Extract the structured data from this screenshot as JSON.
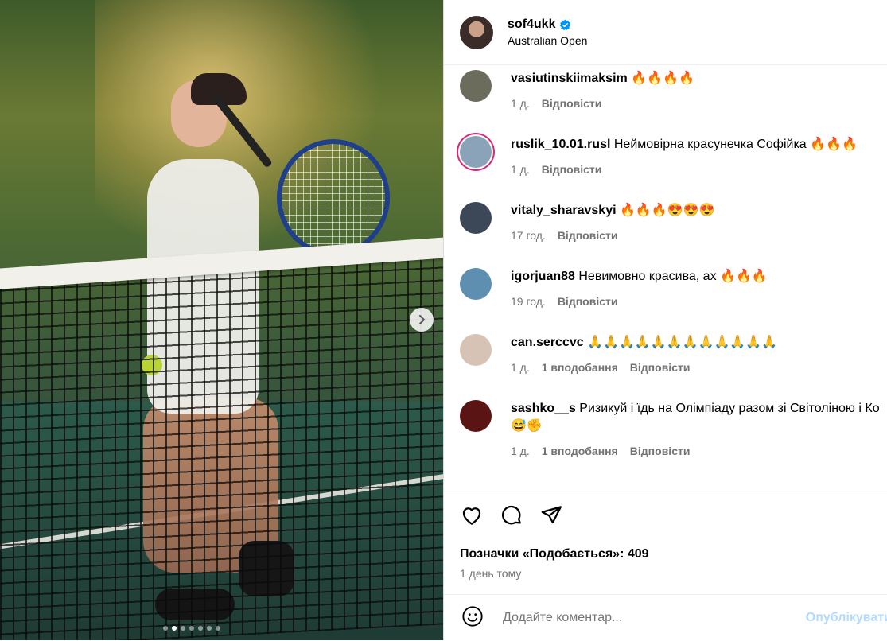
{
  "post": {
    "username": "sof4ukk",
    "location": "Australian Open",
    "verified": true,
    "likes_text": "Позначки «Подобається»: 409",
    "time_ago": "1 день тому",
    "carousel_dots": 7,
    "active_dot": 1
  },
  "comments": [
    {
      "user": "vasiutinskiimaksim",
      "text": "🔥🔥🔥🔥",
      "time": "1 д.",
      "likes": "",
      "reply": "Відповісти",
      "ring": false,
      "avatar": "#6b6c5c"
    },
    {
      "user": "ruslik_10.01.rusl",
      "text": "Неймовірна красунечка Софійка 🔥🔥🔥",
      "time": "1 д.",
      "likes": "",
      "reply": "Відповісти",
      "ring": true,
      "avatar": "#8aa3b8"
    },
    {
      "user": "vitaly_sharavskyi",
      "text": "🔥🔥🔥😍😍😍",
      "time": "17 год.",
      "likes": "",
      "reply": "Відповісти",
      "ring": false,
      "avatar": "#3c4857"
    },
    {
      "user": "igorjuan88",
      "text": "Невимовно красива, ах 🔥🔥🔥",
      "time": "19 год.",
      "likes": "",
      "reply": "Відповісти",
      "ring": false,
      "avatar": "#5e8fb0"
    },
    {
      "user": "can.serccvc",
      "text": "🙏🙏🙏🙏🙏🙏🙏🙏🙏🙏🙏🙏",
      "time": "1 д.",
      "likes": "1 вподобання",
      "reply": "Відповісти",
      "ring": false,
      "avatar": "#d7c3b5"
    },
    {
      "user": "sashko__s",
      "text": "Ризикуй і їдь на Олімпіаду разом зі Світоліною і Ко😅✊",
      "time": "1 д.",
      "likes": "1 вподобання",
      "reply": "Відповісти",
      "ring": false,
      "avatar": "#5a1414"
    }
  ],
  "composer": {
    "placeholder": "Додайте коментар...",
    "post_label": "Опублікувати"
  },
  "icons": [
    "chevron-right-icon",
    "verified-badge-icon",
    "heart-icon",
    "comment-icon",
    "share-icon",
    "emoji-icon"
  ],
  "colors": {
    "accent": "#0095f6",
    "verified": "#0095f6",
    "muted": "#737373",
    "post_disabled": "#b3dbff"
  }
}
